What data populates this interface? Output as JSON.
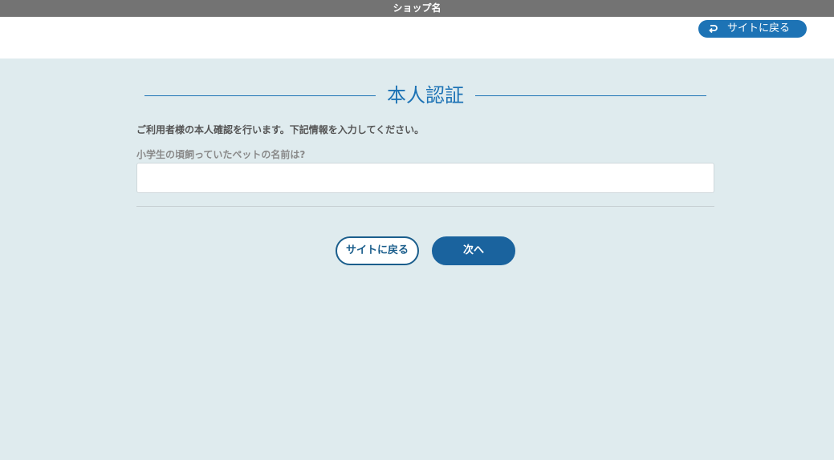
{
  "topbar": {
    "shop_name": "ショップ名"
  },
  "header": {
    "back_to_site_label": "サイトに戻る"
  },
  "main": {
    "title": "本人認証",
    "description": "ご利用者様の本人確認を行います。下記情報を入力してください。",
    "question": "小学生の頃飼っていたペットの名前は?",
    "answer_value": "",
    "back_button_label": "サイトに戻る",
    "next_button_label": "次へ"
  },
  "colors": {
    "topbar_bg": "#737373",
    "accent": "#1d73b5",
    "page_bg": "#dfebee",
    "button_primary": "#1a639e"
  },
  "icons": {
    "back_pill_icon": "return-arrow-icon"
  }
}
